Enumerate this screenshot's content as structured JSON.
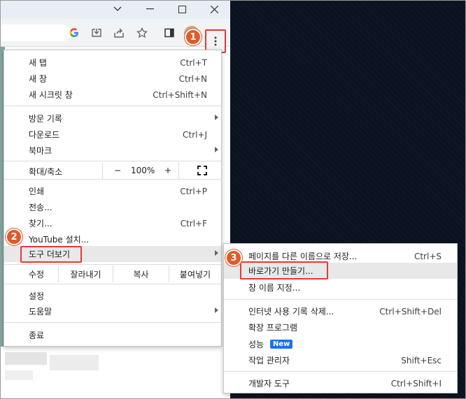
{
  "main_menu": {
    "new_tab": {
      "label": "새 탭",
      "shortcut": "Ctrl+T"
    },
    "new_window": {
      "label": "새 창",
      "shortcut": "Ctrl+N"
    },
    "incognito": {
      "label": "새 시크릿 창",
      "shortcut": "Ctrl+Shift+N"
    },
    "history": {
      "label": "방문 기록"
    },
    "downloads": {
      "label": "다운로드",
      "shortcut": "Ctrl+J"
    },
    "bookmarks": {
      "label": "북마크"
    },
    "zoom": {
      "label": "확대/축소",
      "minus": "−",
      "value": "100%",
      "plus": "+"
    },
    "print": {
      "label": "인쇄",
      "shortcut": "Ctrl+P"
    },
    "cast": {
      "label": "전송..."
    },
    "find": {
      "label": "찾기...",
      "shortcut": "Ctrl+F"
    },
    "youtube": {
      "label": "YouTube 설치..."
    },
    "more_tools": {
      "label": "도구 더보기"
    },
    "edit": {
      "label": "수정",
      "cut": "잘라내기",
      "copy": "복사",
      "paste": "붙여넣기"
    },
    "settings": {
      "label": "설정"
    },
    "help": {
      "label": "도움말"
    },
    "exit": {
      "label": "종료"
    }
  },
  "sub_menu": {
    "save_page": {
      "label": "페이지를 다른 이름으로 저장...",
      "shortcut": "Ctrl+S"
    },
    "create_shortcut": {
      "label": "바로가기 만들기..."
    },
    "name_window": {
      "label": "창 이름 지정..."
    },
    "clear_data": {
      "label": "인터넷 사용 기록 삭제...",
      "shortcut": "Ctrl+Shift+Del"
    },
    "extensions": {
      "label": "확장 프로그램"
    },
    "performance": {
      "label": "성능",
      "badge": "New"
    },
    "task_manager": {
      "label": "작업 관리자",
      "shortcut": "Shift+Esc"
    },
    "dev_tools": {
      "label": "개발자 도구",
      "shortcut": "Ctrl+Shift+I"
    }
  },
  "steps": {
    "one": "1",
    "two": "2",
    "three": "3"
  },
  "colors": {
    "accent_red": "#e53935",
    "step_orange": "#e05a2b",
    "badge_blue": "#1a73e8"
  },
  "icons": [
    "chevron-down-icon",
    "minimize-icon",
    "maximize-icon",
    "close-icon",
    "google-icon",
    "install-icon",
    "share-icon",
    "star-icon",
    "sidepanel-icon",
    "more-vert-icon",
    "fullscreen-icon"
  ]
}
